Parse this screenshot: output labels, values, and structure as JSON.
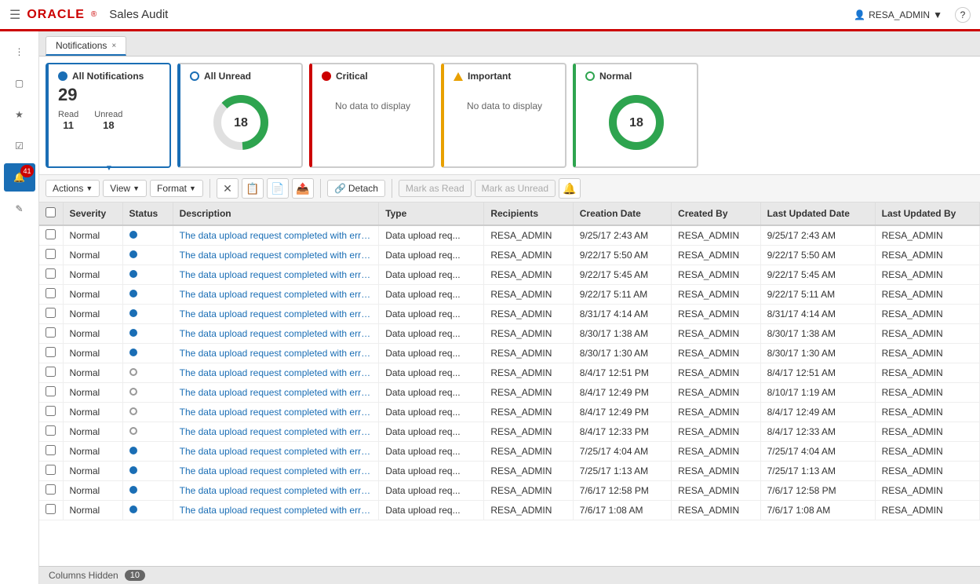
{
  "header": {
    "logo": "ORACLE",
    "app_title": "Sales Audit",
    "user": "RESA_ADMIN",
    "help_icon": "?"
  },
  "tab": {
    "label": "Notifications",
    "close": "×"
  },
  "summary_cards": [
    {
      "id": "all-notifications",
      "title": "All Notifications",
      "count": "29",
      "dot_type": "blue",
      "active": true,
      "sub": [
        {
          "label": "Read",
          "value": "11"
        },
        {
          "label": "Unread",
          "value": "18"
        }
      ]
    },
    {
      "id": "all-unread",
      "title": "All Unread",
      "count": "18",
      "dot_type": "blue-outline",
      "has_donut": true,
      "donut_value": 18,
      "donut_max": 29
    },
    {
      "id": "critical",
      "title": "Critical",
      "dot_type": "red",
      "no_data": "No data to display"
    },
    {
      "id": "important",
      "title": "Important",
      "dot_type": "orange",
      "no_data": "No data to display"
    },
    {
      "id": "normal",
      "title": "Normal",
      "count": "18",
      "dot_type": "green",
      "has_donut": true,
      "donut_value": 18,
      "donut_max": 18
    }
  ],
  "toolbar": {
    "actions_label": "Actions",
    "view_label": "View",
    "format_label": "Format",
    "detach_label": "Detach",
    "mark_read_label": "Mark as Read",
    "mark_unread_label": "Mark as Unread"
  },
  "table": {
    "columns": [
      "Severity",
      "Status",
      "Description",
      "Type",
      "Recipients",
      "Creation Date",
      "Created By",
      "Last Updated Date",
      "Last Updated By"
    ],
    "rows": [
      {
        "severity": "Normal",
        "status": "blue",
        "description": "The data upload request completed with errors for P...",
        "type": "Data upload req...",
        "recipients": "RESA_ADMIN",
        "creation_date": "9/25/17 2:43 AM",
        "created_by": "RESA_ADMIN",
        "last_updated": "9/25/17 2:43 AM",
        "last_updated_by": "RESA_ADMIN"
      },
      {
        "severity": "Normal",
        "status": "blue",
        "description": "The data upload request completed with errors for P...",
        "type": "Data upload req...",
        "recipients": "RESA_ADMIN",
        "creation_date": "9/22/17 5:50 AM",
        "created_by": "RESA_ADMIN",
        "last_updated": "9/22/17 5:50 AM",
        "last_updated_by": "RESA_ADMIN"
      },
      {
        "severity": "Normal",
        "status": "blue",
        "description": "The data upload request completed with errors for P...",
        "type": "Data upload req...",
        "recipients": "RESA_ADMIN",
        "creation_date": "9/22/17 5:45 AM",
        "created_by": "RESA_ADMIN",
        "last_updated": "9/22/17 5:45 AM",
        "last_updated_by": "RESA_ADMIN"
      },
      {
        "severity": "Normal",
        "status": "blue",
        "description": "The data upload request completed with errors for P...",
        "type": "Data upload req...",
        "recipients": "RESA_ADMIN",
        "creation_date": "9/22/17 5:11 AM",
        "created_by": "RESA_ADMIN",
        "last_updated": "9/22/17 5:11 AM",
        "last_updated_by": "RESA_ADMIN"
      },
      {
        "severity": "Normal",
        "status": "blue",
        "description": "The data upload request completed with errors for P...",
        "type": "Data upload req...",
        "recipients": "RESA_ADMIN",
        "creation_date": "8/31/17 4:14 AM",
        "created_by": "RESA_ADMIN",
        "last_updated": "8/31/17 4:14 AM",
        "last_updated_by": "RESA_ADMIN"
      },
      {
        "severity": "Normal",
        "status": "blue",
        "description": "The data upload request completed with errors for P...",
        "type": "Data upload req...",
        "recipients": "RESA_ADMIN",
        "creation_date": "8/30/17 1:38 AM",
        "created_by": "RESA_ADMIN",
        "last_updated": "8/30/17 1:38 AM",
        "last_updated_by": "RESA_ADMIN"
      },
      {
        "severity": "Normal",
        "status": "blue",
        "description": "The data upload request completed with errors for P...",
        "type": "Data upload req...",
        "recipients": "RESA_ADMIN",
        "creation_date": "8/30/17 1:30 AM",
        "created_by": "RESA_ADMIN",
        "last_updated": "8/30/17 1:30 AM",
        "last_updated_by": "RESA_ADMIN"
      },
      {
        "severity": "Normal",
        "status": "gray",
        "description": "The data upload request completed with errors for P...",
        "type": "Data upload req...",
        "recipients": "RESA_ADMIN",
        "creation_date": "8/4/17 12:51 PM",
        "created_by": "RESA_ADMIN",
        "last_updated": "8/4/17 12:51 AM",
        "last_updated_by": "RESA_ADMIN"
      },
      {
        "severity": "Normal",
        "status": "gray",
        "description": "The data upload request completed with errors for P...",
        "type": "Data upload req...",
        "recipients": "RESA_ADMIN",
        "creation_date": "8/4/17 12:49 PM",
        "created_by": "RESA_ADMIN",
        "last_updated": "8/10/17 1:19 AM",
        "last_updated_by": "RESA_ADMIN"
      },
      {
        "severity": "Normal",
        "status": "gray",
        "description": "The data upload request completed with errors for P...",
        "type": "Data upload req...",
        "recipients": "RESA_ADMIN",
        "creation_date": "8/4/17 12:49 PM",
        "created_by": "RESA_ADMIN",
        "last_updated": "8/4/17 12:49 AM",
        "last_updated_by": "RESA_ADMIN"
      },
      {
        "severity": "Normal",
        "status": "gray",
        "description": "The data upload request completed with errors for P...",
        "type": "Data upload req...",
        "recipients": "RESA_ADMIN",
        "creation_date": "8/4/17 12:33 PM",
        "created_by": "RESA_ADMIN",
        "last_updated": "8/4/17 12:33 AM",
        "last_updated_by": "RESA_ADMIN"
      },
      {
        "severity": "Normal",
        "status": "blue",
        "description": "The data upload request completed with errors for P...",
        "type": "Data upload req...",
        "recipients": "RESA_ADMIN",
        "creation_date": "7/25/17 4:04 AM",
        "created_by": "RESA_ADMIN",
        "last_updated": "7/25/17 4:04 AM",
        "last_updated_by": "RESA_ADMIN"
      },
      {
        "severity": "Normal",
        "status": "blue",
        "description": "The data upload request completed with errors for P...",
        "type": "Data upload req...",
        "recipients": "RESA_ADMIN",
        "creation_date": "7/25/17 1:13 AM",
        "created_by": "RESA_ADMIN",
        "last_updated": "7/25/17 1:13 AM",
        "last_updated_by": "RESA_ADMIN"
      },
      {
        "severity": "Normal",
        "status": "blue",
        "description": "The data upload request completed with errors for P...",
        "type": "Data upload req...",
        "recipients": "RESA_ADMIN",
        "creation_date": "7/6/17 12:58 PM",
        "created_by": "RESA_ADMIN",
        "last_updated": "7/6/17 12:58 PM",
        "last_updated_by": "RESA_ADMIN"
      },
      {
        "severity": "Normal",
        "status": "blue",
        "description": "The data upload request completed with errors for P...",
        "type": "Data upload req...",
        "recipients": "RESA_ADMIN",
        "creation_date": "7/6/17 1:08 AM",
        "created_by": "RESA_ADMIN",
        "last_updated": "7/6/17 1:08 AM",
        "last_updated_by": "RESA_ADMIN"
      }
    ]
  },
  "footer": {
    "columns_hidden_label": "Columns Hidden",
    "columns_hidden_count": "10"
  }
}
